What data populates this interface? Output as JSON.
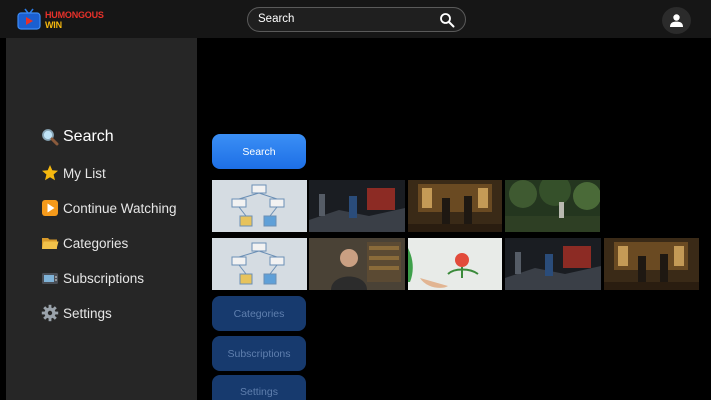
{
  "app": {
    "logo_line1": "HUMONGOUS",
    "logo_line2": "WIN"
  },
  "header": {
    "search_text": "Search"
  },
  "sidebar": {
    "items": [
      {
        "label": "Search",
        "icon": "magnifier-icon"
      },
      {
        "label": "My List",
        "icon": "star-icon"
      },
      {
        "label": "Continue Watching",
        "icon": "play-icon"
      },
      {
        "label": "Categories",
        "icon": "folder-icon"
      },
      {
        "label": "Subscriptions",
        "icon": "tv-icon"
      },
      {
        "label": "Settings",
        "icon": "gear-icon"
      }
    ]
  },
  "main": {
    "buttons": [
      {
        "label": "Search"
      },
      {
        "label": "Categories"
      },
      {
        "label": "Subscriptions"
      },
      {
        "label": "Settings"
      }
    ]
  },
  "colors": {
    "accent": "#2a7ff0",
    "logo_red": "#e8312a",
    "logo_yellow": "#f5b80f",
    "sidebar_bg": "#262626",
    "topbar_bg": "#161616"
  }
}
